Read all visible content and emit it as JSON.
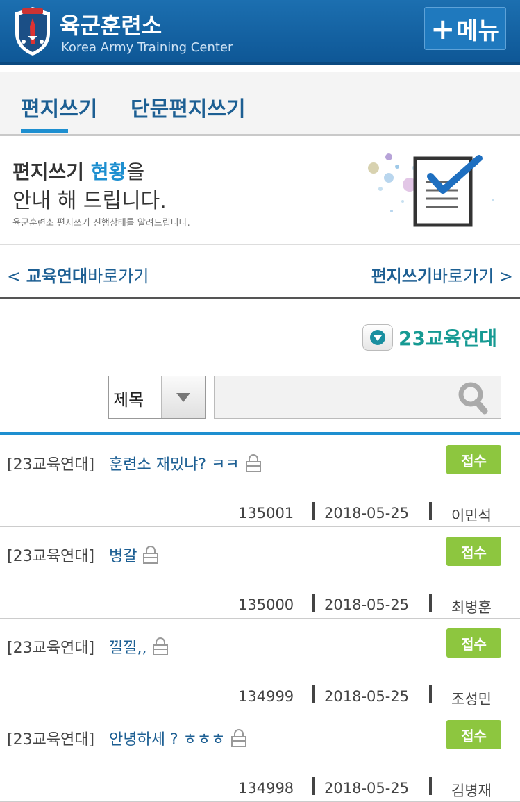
{
  "header": {
    "title_ko": "육군훈련소",
    "title_en": "Korea Army Training Center",
    "menu_label": "메뉴"
  },
  "tabs": [
    {
      "label": "편지쓰기",
      "active": true
    },
    {
      "label": "단문편지쓰기",
      "active": false
    }
  ],
  "notice": {
    "line1_a": "편지쓰기 ",
    "line1_b": "현황",
    "line1_c": "을",
    "line2": "안내 해 드립니다.",
    "sub": "육군훈련소 편지쓰기 진행상태를 알려드립니다."
  },
  "shortcuts": {
    "left_bold": "교육연대",
    "left_rest": "바로가기",
    "right_bold": "편지쓰기",
    "right_rest": "바로가기"
  },
  "unit_selector": {
    "label": "23교육연대"
  },
  "search": {
    "field_value": "제목",
    "query": ""
  },
  "letters": [
    {
      "unit": "[23교육연대]",
      "title": "훈련소 재밌냐? ㅋㅋ",
      "status": "접수",
      "no": "135001",
      "date": "2018-05-25",
      "name": "이민석"
    },
    {
      "unit": "[23교육연대]",
      "title": "병갈",
      "status": "접수",
      "no": "135000",
      "date": "2018-05-25",
      "name": "최병훈"
    },
    {
      "unit": "[23교육연대]",
      "title": "낄낄,,",
      "status": "접수",
      "no": "134999",
      "date": "2018-05-25",
      "name": "조성민"
    },
    {
      "unit": "[23교육연대]",
      "title": "안녕하세 ? ㅎㅎㅎ",
      "status": "접수",
      "no": "134998",
      "date": "2018-05-25",
      "name": "김병재"
    }
  ],
  "colors": {
    "brand": "#0e5796",
    "accent": "#1e8fd0",
    "status": "#8dc63f",
    "unit": "#169a93"
  }
}
